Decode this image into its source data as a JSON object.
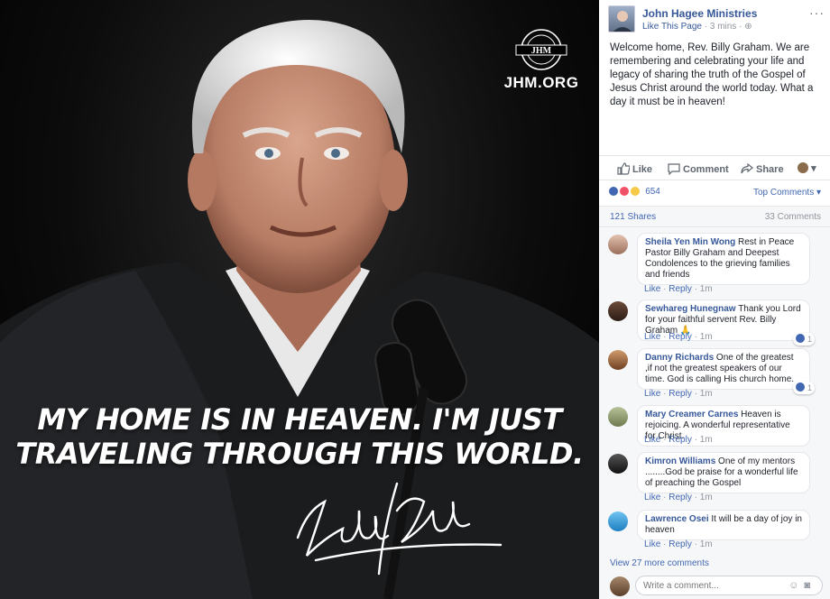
{
  "photo": {
    "logo_text": "JHM.ORG",
    "logo_badge_text": "JHM",
    "quote_line1": "MY HOME IS IN HEAVEN. I'M JUST",
    "quote_line2": "TRAVELING THROUGH THIS WORLD."
  },
  "post": {
    "page_name": "John Hagee Ministries",
    "like_page": "Like This Page",
    "time": "· 3 mins ·",
    "more": "···",
    "text": "Welcome home, Rev. Billy Graham. We are remembering and celebrating your life and legacy of sharing the truth of the Gospel of Jesus Christ around the world today. What a day it must be in heaven!",
    "actions": {
      "like": "Like",
      "comment": "Comment",
      "share": "Share"
    },
    "reaction_count": "654",
    "top_comments": "Top Comments ▾",
    "shares": "121 Shares",
    "comments_count": "33 Comments"
  },
  "comments": [
    {
      "name": "Sheila Yen Min Wong",
      "text": "Rest in Peace Pastor Billy Graham and Deepest Condolences to the grieving families and friends",
      "like": "Like",
      "reply": "Reply",
      "time": "· 1m"
    },
    {
      "name": "Sewhareg Hunegnaw",
      "text": "Thank you Lord for your faithful servent Rev. Billy Graham 🙏",
      "like": "Like",
      "reply": "Reply",
      "time": "· 1m",
      "likes": "1"
    },
    {
      "name": "Danny Richards",
      "text": "One of the greatest ,if not the greatest speakers of our time. God is calling His church home.",
      "like": "Like",
      "reply": "Reply",
      "time": "· 1m",
      "likes": "1"
    },
    {
      "name": "Mary Creamer Carnes",
      "text": "Heaven is rejoicing. A wonderful representative for Christ.",
      "like": "Like",
      "reply": "Reply",
      "time": "· 1m"
    },
    {
      "name": "Kimron Williams",
      "text": "One of my mentors ........God be praise for a wonderful life of preaching the Gospel",
      "like": "Like",
      "reply": "Reply",
      "time": "· 1m"
    },
    {
      "name": "Lawrence Osei",
      "text": "It will be a day of joy in heaven",
      "like": "Like",
      "reply": "Reply",
      "time": "· 1m"
    }
  ],
  "view_more": "View 27 more comments",
  "write_placeholder": "Write a comment...",
  "colors": {
    "fb_blue": "#4267b2",
    "link": "#365899",
    "panel_bg": "#f6f7f9"
  }
}
